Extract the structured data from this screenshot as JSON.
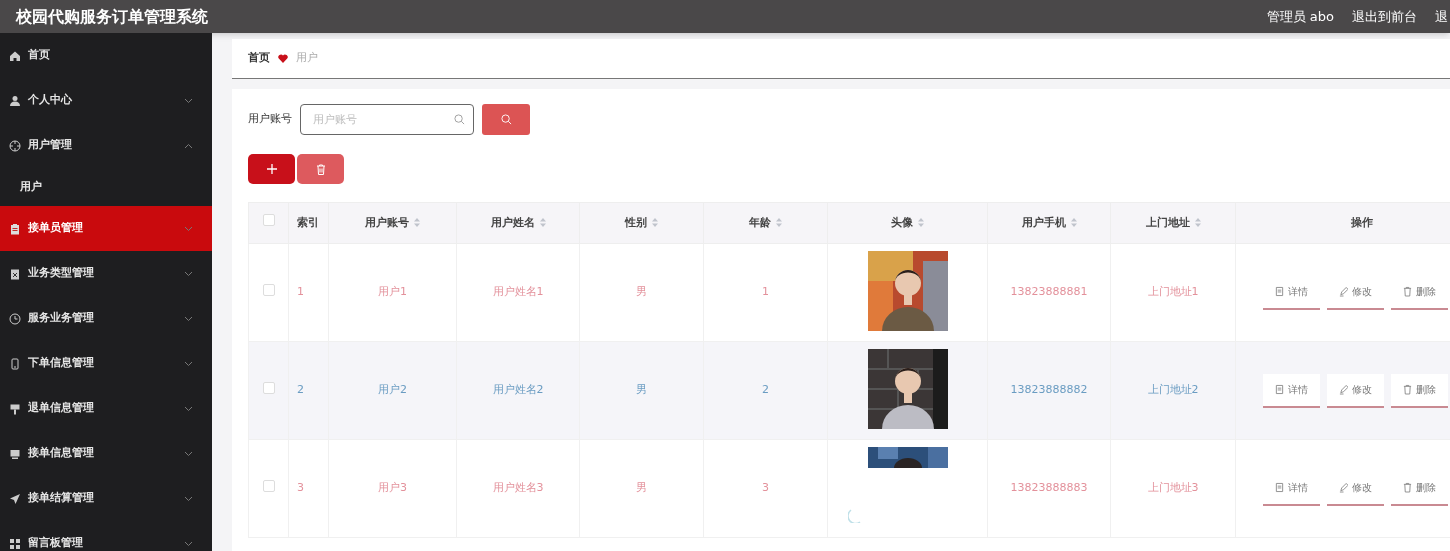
{
  "header": {
    "title": "校园代购服务订单管理系统",
    "links": [
      "管理员 abo",
      "退出到前台",
      "退"
    ]
  },
  "sidebar": {
    "items": [
      {
        "label": "首页",
        "selected": false
      },
      {
        "label": "个人中心",
        "selected": false,
        "expanded": false
      },
      {
        "label": "用户管理",
        "selected": false,
        "expanded": true,
        "children": [
          {
            "label": "用户",
            "selected": false
          }
        ]
      },
      {
        "label": "接单员管理",
        "selected": true,
        "expanded": false
      },
      {
        "label": "业务类型管理",
        "selected": false,
        "expanded": false
      },
      {
        "label": "服务业务管理",
        "selected": false,
        "expanded": false
      },
      {
        "label": "下单信息管理",
        "selected": false,
        "expanded": false
      },
      {
        "label": "退单信息管理",
        "selected": false,
        "expanded": false
      },
      {
        "label": "接单信息管理",
        "selected": false,
        "expanded": false
      },
      {
        "label": "接单结算管理",
        "selected": false,
        "expanded": false
      },
      {
        "label": "留言板管理",
        "selected": false,
        "expanded": false
      }
    ]
  },
  "breadcrumb": [
    "首页",
    "用户"
  ],
  "search": {
    "label": "用户账号",
    "placeholder": "用户账号"
  },
  "table": {
    "header_checked": false,
    "columns": [
      {
        "label": "索引",
        "sortable": false
      },
      {
        "label": "用户账号",
        "sortable": true
      },
      {
        "label": "用户姓名",
        "sortable": true
      },
      {
        "label": "性别",
        "sortable": true
      },
      {
        "label": "年龄",
        "sortable": true
      },
      {
        "label": "头像",
        "sortable": true
      },
      {
        "label": "用户手机",
        "sortable": true
      },
      {
        "label": "上门地址",
        "sortable": true
      },
      {
        "label": "操作",
        "sortable": false
      }
    ],
    "rows": [
      {
        "checked": false,
        "highlighted": false,
        "index": "1",
        "account": "用户1",
        "name": "用户姓名1",
        "gender": "男",
        "age": "1",
        "avatar_loading": false,
        "phone": "13823888881",
        "address": "上门地址1",
        "actions": [
          "详情",
          "修改",
          "删除"
        ]
      },
      {
        "checked": false,
        "highlighted": true,
        "index": "2",
        "account": "用户2",
        "name": "用户姓名2",
        "gender": "男",
        "age": "2",
        "avatar_loading": false,
        "phone": "13823888882",
        "address": "上门地址2",
        "actions": [
          "详情",
          "修改",
          "删除"
        ]
      },
      {
        "checked": false,
        "highlighted": false,
        "index": "3",
        "account": "用户3",
        "name": "用户姓名3",
        "gender": "男",
        "age": "3",
        "avatar_loading": true,
        "phone": "13823888883",
        "address": "上门地址3",
        "actions": [
          "详情",
          "修改",
          "删除"
        ]
      }
    ]
  }
}
